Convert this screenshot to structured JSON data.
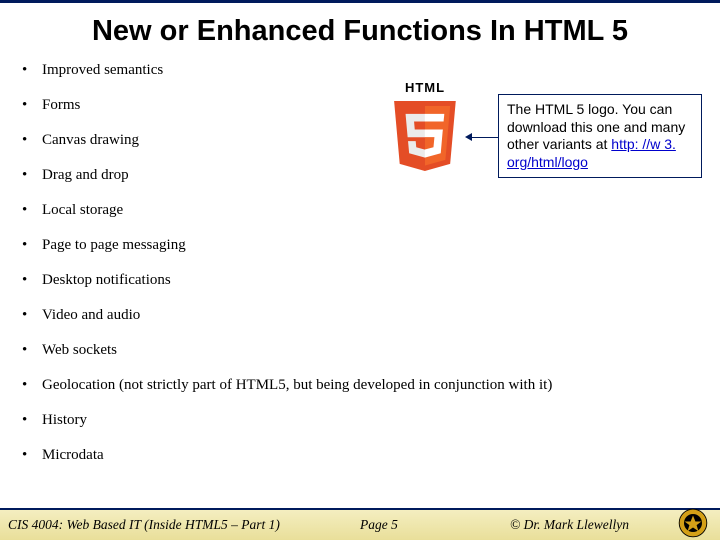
{
  "title": "New or Enhanced Functions In HTML 5",
  "bullets": [
    "Improved semantics",
    "Forms",
    "Canvas drawing",
    "Drag and drop",
    "Local storage",
    "Page to page messaging",
    "Desktop notifications",
    "Video and audio",
    "Web sockets",
    "Geolocation (not strictly part of HTML5, but being developed in conjunction with it)",
    "History",
    "Microdata"
  ],
  "logo_caption": "HTML",
  "callout_text_before": "The HTML 5 logo.  You can download this one and many other variants at ",
  "callout_link_text": "http: //w 3. org/html/logo",
  "callout_link_href": "http://w3.org/html/logo",
  "footer": {
    "left": "CIS 4004: Web Based IT (Inside HTML5 – Part 1)",
    "mid": "Page 5",
    "right": "© Dr. Mark Llewellyn"
  }
}
